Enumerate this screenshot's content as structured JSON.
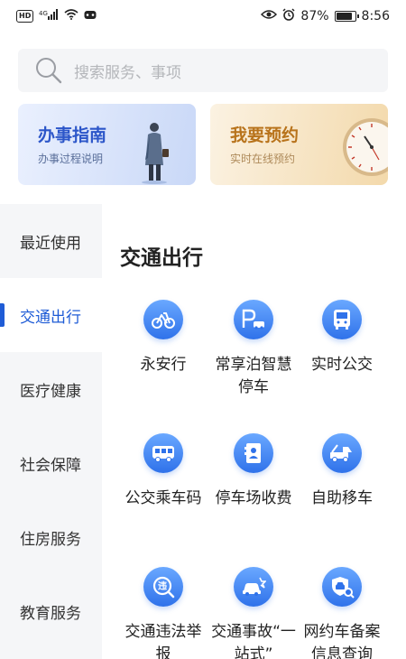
{
  "status_bar": {
    "hd": "HD",
    "network": "4G",
    "battery_percent": "87%",
    "battery_level": 0.87,
    "time": "8:56"
  },
  "search": {
    "placeholder": "搜索服务、事项"
  },
  "banners": {
    "guide": {
      "title": "办事指南",
      "subtitle": "办事过程说明"
    },
    "appointment": {
      "title": "我要预约",
      "subtitle": "实时在线预约"
    }
  },
  "sidebar": {
    "active_index": 1,
    "items": [
      {
        "label": "最近使用"
      },
      {
        "label": "交通出行"
      },
      {
        "label": "医疗健康"
      },
      {
        "label": "社会保障"
      },
      {
        "label": "住房服务"
      },
      {
        "label": "教育服务"
      }
    ]
  },
  "main": {
    "section_title": "交通出行",
    "services": [
      {
        "label": "永安行",
        "icon": "bicycle-icon"
      },
      {
        "label": "常享泊智慧停车",
        "icon": "parking-icon"
      },
      {
        "label": "实时公交",
        "icon": "bus-front-icon"
      },
      {
        "label": "公交乘车码",
        "icon": "bus-side-icon"
      },
      {
        "label": "停车场收费",
        "icon": "parking-fee-icon"
      },
      {
        "label": "自助移车",
        "icon": "tow-truck-icon"
      },
      {
        "label": "交通违法举报",
        "icon": "violation-report-icon"
      },
      {
        "label": "交通事故“一站式”",
        "icon": "car-accident-icon"
      },
      {
        "label": "网约车备案信息查询",
        "icon": "ride-hailing-icon"
      }
    ]
  },
  "colors": {
    "accent": "#1f5cd6",
    "icon_gradient_top": "#6aa8ff",
    "icon_gradient_bottom": "#2f72ea",
    "guide_title": "#2c56c9",
    "appointment_title": "#b8731b"
  }
}
